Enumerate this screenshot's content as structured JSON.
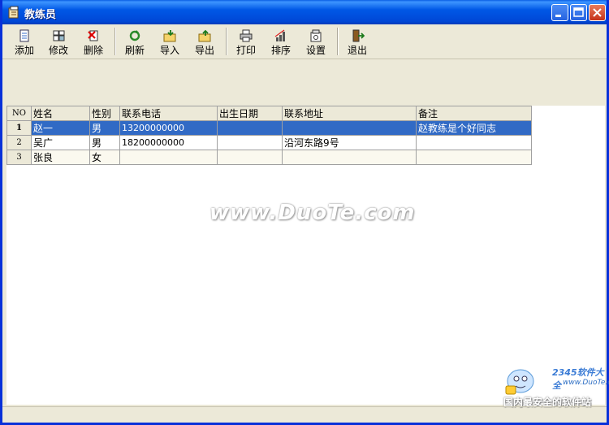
{
  "window": {
    "title": "教练员"
  },
  "toolbar": {
    "buttons": [
      {
        "label": "添加",
        "icon": "add-document-icon"
      },
      {
        "label": "修改",
        "icon": "edit-grid-icon"
      },
      {
        "label": "删除",
        "icon": "delete-icon"
      },
      {
        "label": "刷新",
        "icon": "refresh-icon"
      },
      {
        "label": "导入",
        "icon": "import-folder-icon"
      },
      {
        "label": "导出",
        "icon": "export-folder-icon"
      },
      {
        "label": "打印",
        "icon": "printer-icon"
      },
      {
        "label": "排序",
        "icon": "sort-chart-icon"
      },
      {
        "label": "设置",
        "icon": "settings-icon"
      },
      {
        "label": "退出",
        "icon": "exit-door-icon"
      }
    ]
  },
  "grid": {
    "columns": [
      "NO",
      "姓名",
      "性别",
      "联系电话",
      "出生日期",
      "联系地址",
      "备注"
    ],
    "rows": [
      [
        "1",
        "赵一",
        "男",
        "13200000000",
        "",
        "",
        "赵教练是个好同志"
      ],
      [
        "2",
        "吴广",
        "男",
        "18200000000",
        "",
        "沿河东路9号",
        ""
      ],
      [
        "3",
        "张良",
        "女",
        "",
        "",
        "",
        ""
      ]
    ],
    "selected_row": 1
  },
  "watermark": {
    "text": "www.DuoTe.com"
  },
  "logo": {
    "brand": "2345软件大全",
    "url": "www.DuoTe.com",
    "tagline": "国内最安全的软件站"
  },
  "colors": {
    "titlebar": "#0058e6",
    "selection": "#316ac5",
    "face": "#ece9d8"
  }
}
